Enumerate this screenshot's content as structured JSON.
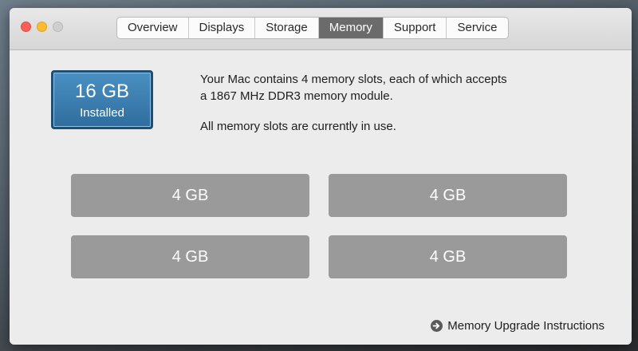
{
  "window": {
    "controls": [
      "close",
      "minimize",
      "zoom"
    ]
  },
  "tabs": [
    {
      "label": "Overview",
      "active": false
    },
    {
      "label": "Displays",
      "active": false
    },
    {
      "label": "Storage",
      "active": false
    },
    {
      "label": "Memory",
      "active": true
    },
    {
      "label": "Support",
      "active": false
    },
    {
      "label": "Service",
      "active": false
    }
  ],
  "memory": {
    "total": "16 GB",
    "total_caption": "Installed",
    "description": "Your Mac contains 4 memory slots, each of which accepts",
    "description_line2": "a 1867 MHz DDR3 memory module.",
    "status": "All memory slots are currently in use.",
    "slots": [
      "4 GB",
      "4 GB",
      "4 GB",
      "4 GB"
    ]
  },
  "upgrade": {
    "label": "Memory Upgrade Instructions",
    "icon": "arrow-right-circle-icon"
  },
  "colors": {
    "badge": "#3a7cad",
    "active_tab": "#6b6b6b",
    "slot": "#9a9a9a"
  }
}
